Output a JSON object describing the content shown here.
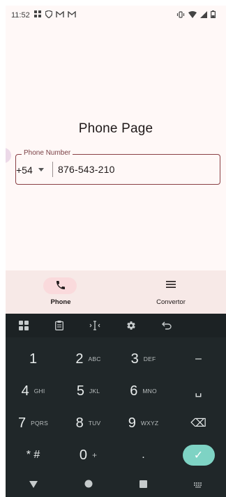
{
  "status_bar": {
    "time": "11:52",
    "icons": [
      "grid-notification-icon",
      "shield-icon",
      "gmail-icon",
      "gmail-icon",
      "vibrate-icon",
      "wifi-icon",
      "signal-icon",
      "battery-icon"
    ]
  },
  "page": {
    "title": "Phone Page"
  },
  "phone_field": {
    "label": "Phone Number",
    "country_code": "+54",
    "value": "876-543-210"
  },
  "bottom_nav": {
    "items": [
      {
        "label": "Phone",
        "icon": "phone-icon",
        "active": true
      },
      {
        "label": "Convertor",
        "icon": "menu-icon",
        "active": false
      }
    ]
  },
  "keyboard": {
    "toolbar": [
      "apps-icon",
      "clipboard-icon",
      "cursor-icon",
      "settings-icon",
      "undo-icon"
    ],
    "rows": [
      [
        {
          "num": "1",
          "letters": ""
        },
        {
          "num": "2",
          "letters": "ABC"
        },
        {
          "num": "3",
          "letters": "DEF"
        },
        {
          "num": "–",
          "letters": ""
        }
      ],
      [
        {
          "num": "4",
          "letters": "GHI"
        },
        {
          "num": "5",
          "letters": "JKL"
        },
        {
          "num": "6",
          "letters": "MNO"
        },
        {
          "num": "␣",
          "letters": ""
        }
      ],
      [
        {
          "num": "7",
          "letters": "PQRS"
        },
        {
          "num": "8",
          "letters": "TUV"
        },
        {
          "num": "9",
          "letters": "WXYZ"
        },
        {
          "num": "⌫",
          "letters": ""
        }
      ],
      [
        {
          "num": "* #",
          "letters": ""
        },
        {
          "num": "0",
          "letters": "+"
        },
        {
          "num": ".",
          "letters": ""
        },
        {
          "num": "✓",
          "letters": ""
        }
      ]
    ],
    "accent_color": "#7ed3c4"
  },
  "system_nav": [
    "back-icon",
    "home-icon",
    "recents-icon",
    "keyboard-switch-icon"
  ],
  "colors": {
    "background": "#fff8f7",
    "field_border": "#8a3f44",
    "nav_background": "#f7e9e7",
    "nav_active_pill": "#fadadc",
    "keyboard_bg": "#202729"
  }
}
